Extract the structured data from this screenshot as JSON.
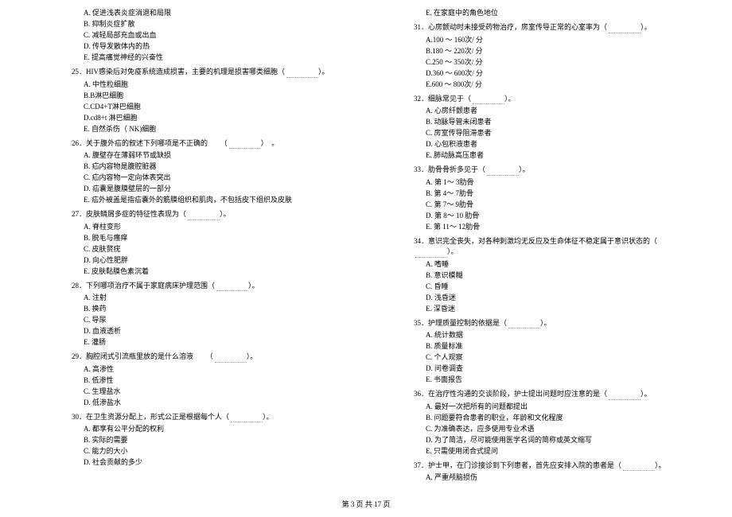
{
  "footer": "第 3 页 共 17 页",
  "left_column": [
    {
      "type": "option",
      "text": "A. 促进浅表炎症消退和局限"
    },
    {
      "type": "option",
      "text": "B. 抑制炎症扩散"
    },
    {
      "type": "option",
      "text": "C. 减轻局部充血或出血"
    },
    {
      "type": "option",
      "text": "D. 传导发散体内的热"
    },
    {
      "type": "option",
      "text": "E. 提高痛觉神经的兴奋性"
    },
    {
      "type": "question",
      "text": "25．HIV感染后对免疫系统造成损害，主要的机理是损害哪类细胞（　　　　）。"
    },
    {
      "type": "option",
      "text": "A. 中性粒细胞"
    },
    {
      "type": "option",
      "text": "B.B淋巴细胞"
    },
    {
      "type": "option",
      "text": "C.CD4+T淋巴细胞"
    },
    {
      "type": "option",
      "text": "D.cd8+t 淋巴细胞"
    },
    {
      "type": "option",
      "text": "E. 自然杀伤（ NK)细胞"
    },
    {
      "type": "question",
      "text": "26．关于腹外疝的叙述下列哪项是不正确的 　　（　　）　。"
    },
    {
      "type": "option",
      "text": "A. 腹壁存在薄弱环节或缺损"
    },
    {
      "type": "option",
      "text": "B. 疝内容物是腹腔脏器"
    },
    {
      "type": "option",
      "text": "C. 疝内容物一定向体表突出"
    },
    {
      "type": "option",
      "text": "D. 疝囊是腹膜壁层的一部分"
    },
    {
      "type": "option",
      "text": "E. 疝外被盖是指疝囊外的筋膜组织和肌肉，不包括皮下组织及皮肤"
    },
    {
      "type": "question",
      "text": "27．皮肤鳞屑多症的特征性表现为（　　　　）。"
    },
    {
      "type": "option",
      "text": "A. 脊柱变形"
    },
    {
      "type": "option",
      "text": "B. 脱毛与瘙痒"
    },
    {
      "type": "option",
      "text": "C. 皮肤赘疣"
    },
    {
      "type": "option",
      "text": "D. 向心性肥胖"
    },
    {
      "type": "option",
      "text": "E. 皮肤黏膜色素沉着"
    },
    {
      "type": "question",
      "text": "28．下列哪项治疗不属于家庭病床护理范围（　　　　）。"
    },
    {
      "type": "option",
      "text": "A. 注射"
    },
    {
      "type": "option",
      "text": "B. 换药"
    },
    {
      "type": "option",
      "text": "C. 导尿"
    },
    {
      "type": "option",
      "text": "D. 血液透析"
    },
    {
      "type": "option",
      "text": "E. 灌肠"
    },
    {
      "type": "question",
      "text": "29．胸腔闭式引流瓶里放的是什么溶液 　　（　　）。"
    },
    {
      "type": "option",
      "text": "A. 高渗性"
    },
    {
      "type": "option",
      "text": "B. 低渗性"
    },
    {
      "type": "option",
      "text": "C. 生理盐水"
    },
    {
      "type": "option",
      "text": "D. 低渗盐水"
    },
    {
      "type": "question",
      "text": "30．在卫生资源分配上，形式公正是根据每个人（　　　　）。"
    },
    {
      "type": "option",
      "text": "A. 都享有公平分配的权利"
    },
    {
      "type": "option",
      "text": "B. 实际的需要"
    },
    {
      "type": "option",
      "text": "C. 能力的大小"
    },
    {
      "type": "option",
      "text": "D. 社会贡献的多少"
    }
  ],
  "right_column": [
    {
      "type": "option",
      "text": "E. 在家庭中的角色地位"
    },
    {
      "type": "question",
      "text": "31．心房颤动时未接受药物治疗，房室传导正常的心室率为（　　　　）。"
    },
    {
      "type": "option",
      "text": "A.100 ～ 160次/ 分"
    },
    {
      "type": "option",
      "text": "B.180 ～ 220次/ 分"
    },
    {
      "type": "option",
      "text": "C.250 ～ 350次/ 分"
    },
    {
      "type": "option",
      "text": "D.360 ～ 600次/ 分"
    },
    {
      "type": "option",
      "text": "E.600 ～ 800次/ 分"
    },
    {
      "type": "question",
      "text": "32．细脉常见于（　　　　）。"
    },
    {
      "type": "option",
      "text": "A. 心房纤颤患者"
    },
    {
      "type": "option",
      "text": "B. 动脉导管未闭患者"
    },
    {
      "type": "option",
      "text": "C. 房室传导阻滞患者"
    },
    {
      "type": "option",
      "text": "D. 心包积液患者"
    },
    {
      "type": "option",
      "text": "E. 肺动脉高压患者"
    },
    {
      "type": "question",
      "text": "33．肋骨骨折多见于（　　　　）。"
    },
    {
      "type": "option",
      "text": "A.  第 1～ 3肋骨"
    },
    {
      "type": "option",
      "text": "B.  第 4～ 7肋骨"
    },
    {
      "type": "option",
      "text": "C.  第 7～ 9肋骨"
    },
    {
      "type": "option",
      "text": "D.  第 8～ 10 肋骨"
    },
    {
      "type": "option",
      "text": "E.  第 11～ 12肋骨"
    },
    {
      "type": "question",
      "text": "34．意识完全丧失，对各种刺激均无反应及生命体征不稳定属于意识状态的（　　　　）。"
    },
    {
      "type": "option",
      "text": "A. 嗜睡"
    },
    {
      "type": "option",
      "text": "B. 意识模糊"
    },
    {
      "type": "option",
      "text": "C. 昏睡"
    },
    {
      "type": "option",
      "text": "D. 浅昏迷"
    },
    {
      "type": "option",
      "text": "E. 深昏迷"
    },
    {
      "type": "question",
      "text": "35．护理质量控制的依据是（　　　　）。"
    },
    {
      "type": "option",
      "text": "A. 统计数据"
    },
    {
      "type": "option",
      "text": "B. 质量标准"
    },
    {
      "type": "option",
      "text": "C. 个人观察"
    },
    {
      "type": "option",
      "text": "D. 问卷调查"
    },
    {
      "type": "option",
      "text": "E. 书面报告"
    },
    {
      "type": "question",
      "text": "36．在治疗性沟通的交谈阶段，护士提出问题时应注意的是（　　　　）。"
    },
    {
      "type": "option",
      "text": "A. 最好一次把所有的问题都提出"
    },
    {
      "type": "option",
      "text": "B. 问题要符合患者的职业，年龄和文化程度"
    },
    {
      "type": "option",
      "text": "C. 为准确表达，应多使用专业术语"
    },
    {
      "type": "option",
      "text": "D. 为了简洁，尽可能使用医学名词的简称或英文缩写"
    },
    {
      "type": "option",
      "text": "E. 只需使用闭合式提问"
    },
    {
      "type": "question",
      "text": "37．护士甲，在门诊接诊到下列患者，首先应安排入院的患者是（　　　　）。"
    },
    {
      "type": "option",
      "text": "A. 严重颅脑损伤"
    }
  ]
}
